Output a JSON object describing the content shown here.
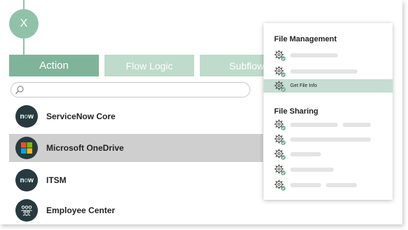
{
  "close_button": {
    "label": "X"
  },
  "tabs": [
    {
      "label": "Action",
      "active": true
    },
    {
      "label": "Flow Logic",
      "active": false
    },
    {
      "label": "Subflow",
      "active": false
    }
  ],
  "search": {
    "value": "",
    "placeholder": ""
  },
  "list_items": [
    {
      "label": "ServiceNow Core",
      "icon": "servicenow-logo-icon",
      "selected": false
    },
    {
      "label": "Microsoft OneDrive",
      "icon": "microsoft-logo-icon",
      "selected": true
    },
    {
      "label": "ITSM",
      "icon": "servicenow-logo-icon",
      "selected": false
    },
    {
      "label": "Employee Center",
      "icon": "people-group-icon",
      "selected": false
    }
  ],
  "panel": {
    "sections": [
      {
        "title": "File Management",
        "items": [
          {
            "label": ""
          },
          {
            "label": ""
          },
          {
            "label": "Get File Info",
            "highlighted": true
          }
        ]
      },
      {
        "title": "File Sharing",
        "items": [
          {
            "label": ""
          },
          {
            "label": ""
          },
          {
            "label": ""
          },
          {
            "label": ""
          },
          {
            "label": ""
          }
        ]
      }
    ]
  },
  "colors": {
    "accent": "#7fb49a",
    "accent_light": "#bedbcc",
    "dark_icon_bg": "#273a40",
    "highlight": "#c5ddd2",
    "selected_row": "#cfcfcf"
  }
}
